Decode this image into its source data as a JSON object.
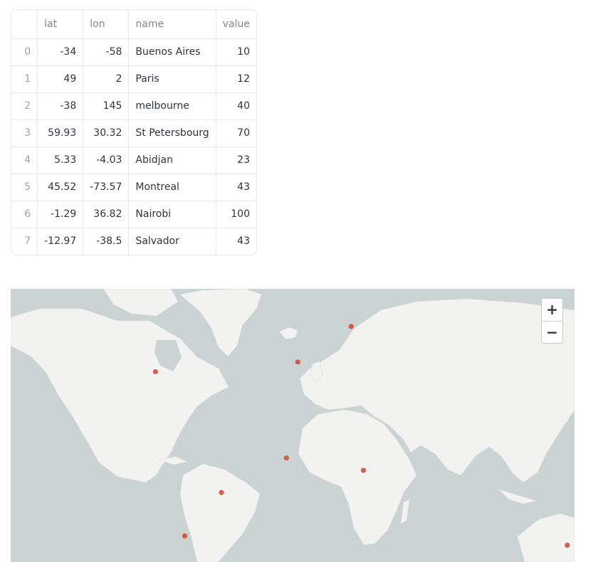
{
  "table": {
    "columns": [
      "",
      "lat",
      "lon",
      "name",
      "value"
    ],
    "rows": [
      {
        "index": "0",
        "lat": "-34",
        "lon": "-58",
        "name": "Buenos Aires",
        "value": "10"
      },
      {
        "index": "1",
        "lat": "49",
        "lon": "2",
        "name": "Paris",
        "value": "12"
      },
      {
        "index": "2",
        "lat": "-38",
        "lon": "145",
        "name": "melbourne",
        "value": "40"
      },
      {
        "index": "3",
        "lat": "59.93",
        "lon": "30.32",
        "name": "St Petersbourg",
        "value": "70"
      },
      {
        "index": "4",
        "lat": "5.33",
        "lon": "-4.03",
        "name": "Abidjan",
        "value": "23"
      },
      {
        "index": "5",
        "lat": "45.52",
        "lon": "-73.57",
        "name": "Montreal",
        "value": "43"
      },
      {
        "index": "6",
        "lat": "-1.29",
        "lon": "36.82",
        "name": "Nairobi",
        "value": "100"
      },
      {
        "index": "7",
        "lat": "-12.97",
        "lon": "-38.5",
        "name": "Salvador",
        "value": "43"
      }
    ]
  },
  "map": {
    "zoom_in_label": "+",
    "zoom_out_label": "−",
    "icons": [
      "plus-icon",
      "minus-icon"
    ],
    "colors": {
      "water": "#cad2d3",
      "land": "#f2f2f1",
      "marker": "#cf4a35"
    }
  }
}
